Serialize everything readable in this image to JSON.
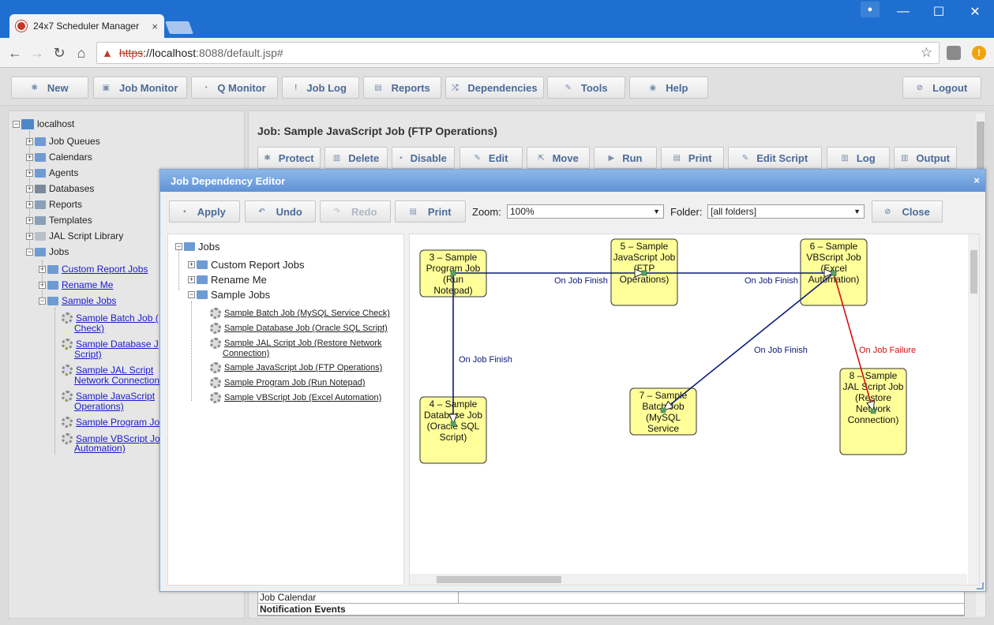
{
  "browser": {
    "tab_title": "24x7 Scheduler Manager",
    "tab_close": "×",
    "url_scheme": "https",
    "url_host": "://localhost",
    "url_rest": ":8088/default.jsp#",
    "min_glyph": "—",
    "max_glyph": "☐",
    "close_glyph": "✕"
  },
  "toolbar": {
    "items": [
      {
        "label": "New",
        "icon": "new-icon"
      },
      {
        "label": "Job Monitor",
        "icon": "job-monitor-icon"
      },
      {
        "label": "Q Monitor",
        "icon": "q-monitor-icon"
      },
      {
        "label": "Job Log",
        "icon": "job-log-icon"
      },
      {
        "label": "Reports",
        "icon": "reports-icon"
      },
      {
        "label": "Dependencies",
        "icon": "dependencies-icon"
      },
      {
        "label": "Tools",
        "icon": "tools-icon"
      },
      {
        "label": "Help",
        "icon": "help-icon"
      }
    ],
    "logout": "Logout"
  },
  "tree": {
    "root": "localhost",
    "items": [
      "Job Queues",
      "Calendars",
      "Agents",
      "Databases",
      "Reports",
      "Templates",
      "JAL Script Library",
      "Jobs"
    ],
    "jobs_children": [
      "Custom Report Jobs",
      "Rename Me",
      "Sample Jobs"
    ],
    "sample_jobs": [
      {
        "line1": "Sample Batch Job (",
        "line2": "Check)"
      },
      {
        "line1": "Sample Database J",
        "line2": "Script)"
      },
      {
        "line1": "Sample JAL Script",
        "line2": "Network Connection"
      },
      {
        "line1": "Sample JavaScript",
        "line2": "Operations)"
      },
      {
        "line1": "Sample Program Jo",
        "line2": ""
      },
      {
        "line1": "Sample VBScript Jo",
        "line2": "Automation)"
      }
    ]
  },
  "job_panel": {
    "title": "Job: Sample JavaScript Job (FTP Operations)",
    "actions": [
      "Protect",
      "Delete",
      "Disable",
      "Edit",
      "Move",
      "Run",
      "Print",
      "Edit Script",
      "Log",
      "Output"
    ],
    "rows": [
      "Job Calendar",
      "Notification Events"
    ]
  },
  "dialog": {
    "title": "Job Dependency Editor",
    "close": "×",
    "buttons": {
      "apply": "Apply",
      "undo": "Undo",
      "redo": "Redo",
      "print": "Print",
      "close": "Close"
    },
    "zoom_label": "Zoom:",
    "zoom_value": "100%",
    "folder_label": "Folder:",
    "folder_value": "[all folders]",
    "tree_root": "Jobs",
    "tree_folders": [
      "Custom Report Jobs",
      "Rename Me",
      "Sample Jobs"
    ],
    "tree_jobs": [
      "Sample Batch Job (MySQL Service Check)",
      "Sample Database Job (Oracle SQL Script)",
      "Sample JAL Script Job (Restore Network",
      "Connection)",
      "Sample JavaScript Job (FTP Operations)",
      "Sample Program Job (Run Notepad)",
      "Sample VBScript Job (Excel Automation)"
    ]
  },
  "graph": {
    "nodes": [
      {
        "lines": [
          "3 – Sample",
          "Program Job",
          "(Run",
          "Notepad)"
        ]
      },
      {
        "lines": [
          "5 – Sample",
          "JavaScript Job",
          "(FTP",
          "Operations)"
        ]
      },
      {
        "lines": [
          "6 – Sample",
          "VBScript Job",
          "(Excel",
          "Automation)"
        ]
      },
      {
        "lines": [
          "4 – Sample",
          "Database Job",
          "(Oracle SQL",
          "Script)"
        ]
      },
      {
        "lines": [
          "7 – Sample",
          "Batch Job",
          "(MySQL",
          "Service"
        ]
      },
      {
        "lines": [
          "8 – Sample",
          "JAL Script Job",
          "(Restore",
          "Network",
          "Connection)"
        ]
      }
    ],
    "edges": [
      {
        "label": "On Job Finish",
        "color": "#0a1a7a"
      },
      {
        "label": "On Job Finish",
        "color": "#0a1a7a"
      },
      {
        "label": "On Job Finish",
        "color": "#0a1a7a"
      },
      {
        "label": "On Job Finish",
        "color": "#0a1a7a"
      },
      {
        "label": "On Job Failure",
        "color": "#d41010"
      }
    ]
  },
  "colors": {
    "chrome_blue": "#1f6fd1",
    "button_text": "#4a6a9a",
    "node_fill": "#ffff99",
    "link": "#1a1ad0"
  }
}
